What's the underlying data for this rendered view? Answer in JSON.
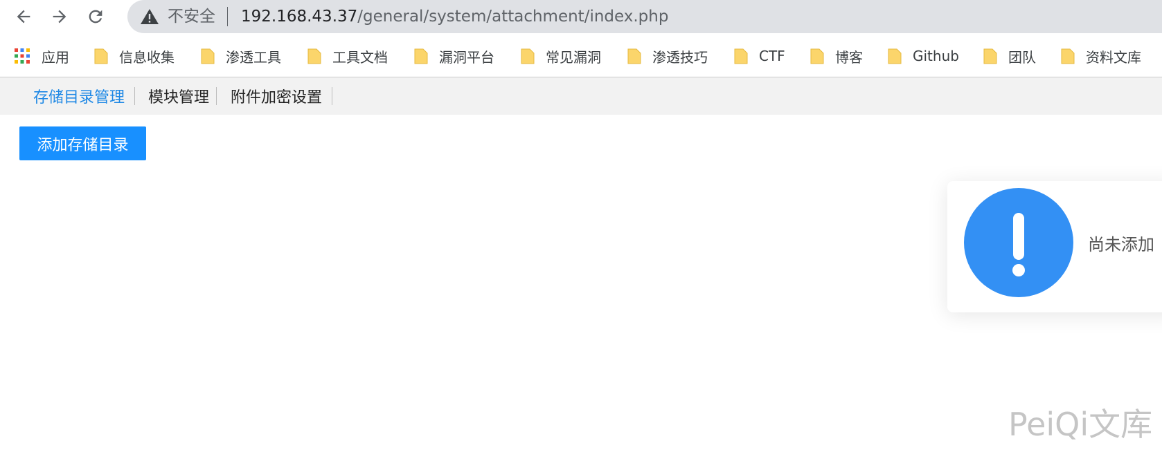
{
  "browser": {
    "address": {
      "security_label": "不安全",
      "host": "192.168.43.37",
      "path": "/general/system/attachment/index.php"
    },
    "icons": {
      "back": "arrow-left-icon",
      "forward": "arrow-right-icon",
      "reload": "reload-icon",
      "security": "warning-triangle-icon"
    },
    "bookmarks": {
      "apps_label": "应用",
      "items": [
        {
          "label": "信息收集"
        },
        {
          "label": "渗透工具"
        },
        {
          "label": "工具文档"
        },
        {
          "label": "漏洞平台"
        },
        {
          "label": "常见漏洞"
        },
        {
          "label": "渗透技巧"
        },
        {
          "label": "CTF"
        },
        {
          "label": "博客"
        },
        {
          "label": "Github"
        },
        {
          "label": "团队"
        },
        {
          "label": "资料文库"
        }
      ],
      "folder_color": "#fbd56b"
    }
  },
  "page": {
    "tabs": [
      {
        "label": "存储目录管理",
        "active": true
      },
      {
        "label": "模块管理",
        "active": false
      },
      {
        "label": "附件加密设置",
        "active": false
      }
    ],
    "add_button_label": "添加存储目录",
    "notice": {
      "icon": "exclamation-circle-icon",
      "text": "尚未添加"
    },
    "watermark": "PeiQi文库",
    "colors": {
      "accent": "#1890ff",
      "active_tab": "#1e88e5",
      "notice_icon": "#3390f4"
    }
  }
}
